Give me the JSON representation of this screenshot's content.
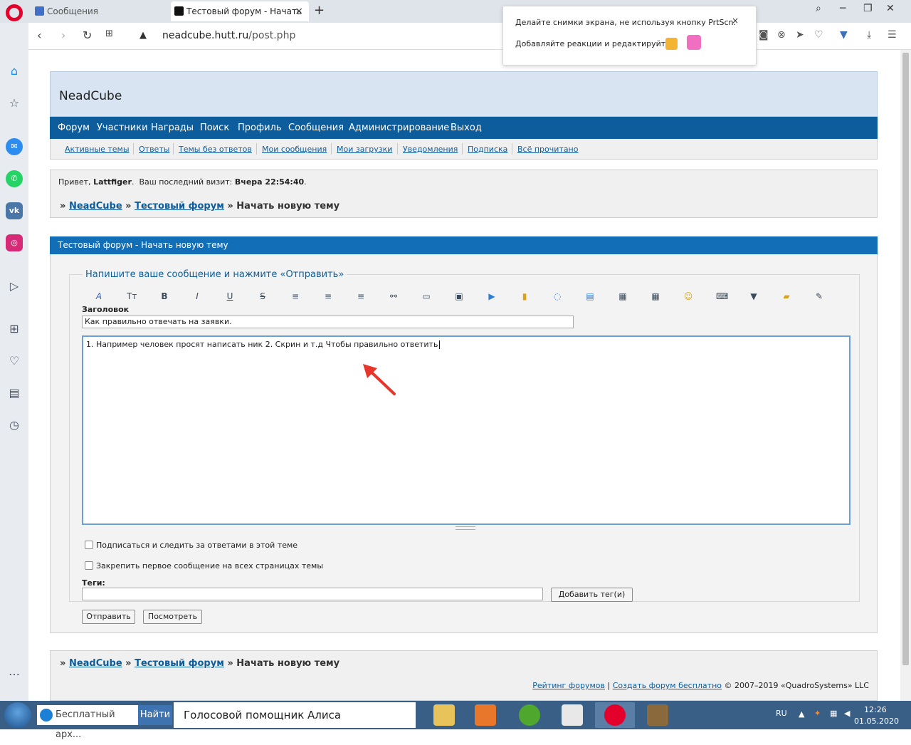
{
  "browser": {
    "tabs": [
      {
        "label": "Сообщения"
      },
      {
        "label": "Тестовый форум - Начать"
      }
    ],
    "new_tab": "+",
    "url_host": "neadcube.hutt.ru",
    "url_path": "/post.php"
  },
  "popup": {
    "line1": "Делайте снимки экрана, не используя кнопку PrtScn.",
    "line2": "Добавляйте реакции и редактируйте",
    "close": "×"
  },
  "site": {
    "title": "NeadCube",
    "main_nav": [
      "Форум",
      "Участники",
      "Награды",
      "Поиск",
      "Профиль",
      "Сообщения",
      "Администрирование",
      "Выход"
    ],
    "sub_nav": [
      "Активные темы",
      "Ответы",
      "Темы без ответов",
      "Мои сообщения",
      "Мои загрузки",
      "Уведомления",
      "Подписка",
      "Всё прочитано"
    ],
    "welcome_prefix": "Привет,",
    "username": "Lattfiger",
    "visit_prefix": "Ваш последний визит:",
    "visit_time": "Вчера 22:54:40",
    "crumbs": {
      "sep": "»",
      "home": "NeadCube",
      "forum": "Тестовый форум",
      "current": "Начать новую тему"
    }
  },
  "form": {
    "header": "Тестовый форум - Начать новую тему",
    "legend": "Напишите ваше сообщение и нажмите «Отправить»",
    "toolbar": [
      {
        "name": "font-icon",
        "glyph": "A"
      },
      {
        "name": "font-size-icon",
        "glyph": "Tт"
      },
      {
        "name": "bold-icon",
        "glyph": "B"
      },
      {
        "name": "italic-icon",
        "glyph": "I"
      },
      {
        "name": "underline-icon",
        "glyph": "U"
      },
      {
        "name": "strikethrough-icon",
        "glyph": "S"
      },
      {
        "name": "align-left-icon",
        "glyph": "≡"
      },
      {
        "name": "align-center-icon",
        "glyph": "≡"
      },
      {
        "name": "align-right-icon",
        "glyph": "≡"
      },
      {
        "name": "link-icon",
        "glyph": "⚯"
      },
      {
        "name": "book-icon",
        "glyph": "▭"
      },
      {
        "name": "image-icon",
        "glyph": "▣"
      },
      {
        "name": "video-icon",
        "glyph": "▶"
      },
      {
        "name": "lock-icon",
        "glyph": "▮"
      },
      {
        "name": "comment-icon",
        "glyph": "◌"
      },
      {
        "name": "code-icon",
        "glyph": "▤"
      },
      {
        "name": "color-icon",
        "glyph": "▦"
      },
      {
        "name": "table-icon",
        "glyph": "▦"
      },
      {
        "name": "smile-icon",
        "glyph": "☺"
      },
      {
        "name": "keyboard-icon",
        "glyph": "⌨"
      },
      {
        "name": "dropdown-icon",
        "glyph": "▼"
      },
      {
        "name": "folder-icon",
        "glyph": "▰"
      },
      {
        "name": "edit-icon",
        "glyph": "✎"
      }
    ],
    "title_label": "Заголовок",
    "title_value": "Как правильно отвечать на заявки.",
    "message_value": "1. Например человек просят написать ник 2. Скрин и т.д Чтобы правильно ответить",
    "subscribe_label": "Подписаться и следить за ответами в этой теме",
    "pin_label": "Закрепить первое сообщение на всех страницах темы",
    "tags_label": "Теги:",
    "add_tags_button": "Добавить тег(и)",
    "submit_button": "Отправить",
    "preview_button": "Посмотреть"
  },
  "footer": {
    "rating_link": "Рейтинг форумов",
    "divider": "|",
    "create_link": "Создать форум бесплатно",
    "copyright": "© 2007–2019 «QuadroSystems» LLC"
  },
  "taskbar": {
    "search_text": "Бесплатный арх...",
    "find_button": "Найти",
    "assistant": "Голосовой помощник Алиса",
    "lang": "RU",
    "time": "12:26",
    "date": "01.05.2020"
  }
}
